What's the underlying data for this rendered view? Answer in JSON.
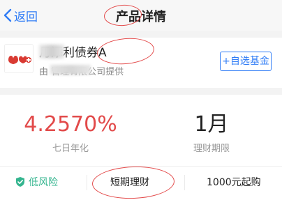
{
  "nav": {
    "back_label": "返回",
    "title": "产品详情"
  },
  "fund": {
    "name": "月添利债券A",
    "provider": "由 管理有限公司提供",
    "add_button": "+自选基金"
  },
  "stats": {
    "yield_value": "4.2570%",
    "yield_label": "七日年化",
    "term_value": "1月",
    "term_label": "理财期限"
  },
  "tags": {
    "risk": "低风险",
    "type": "短期理财",
    "min_purchase": "1000元起购"
  },
  "colors": {
    "accent_blue": "#2f7cf6",
    "value_red": "#e24a4a",
    "risk_green": "#35b58f"
  }
}
